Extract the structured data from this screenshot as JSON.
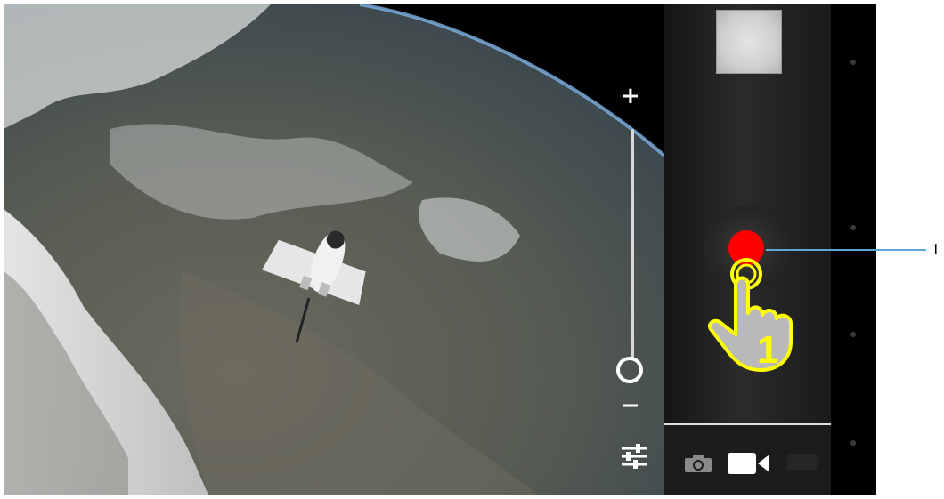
{
  "viewfinder": {
    "scene": "shuttle-over-earth",
    "zoom_in_symbol": "+",
    "zoom_out_symbol": "−",
    "zoom_level": 0.0
  },
  "controls": {
    "thumbnail_icon": "last-photo-thumbnail",
    "shutter_icon": "video-record-button",
    "record_color": "#ff0000",
    "settings_icon": "sliders-icon"
  },
  "modes": {
    "items": [
      {
        "icon": "camera-icon",
        "selected": false
      },
      {
        "icon": "video-camera-icon",
        "selected": true
      },
      {
        "icon": "panorama-icon",
        "selected": false
      }
    ]
  },
  "annotation": {
    "finger_step": "1",
    "callout_label": "1",
    "callout_color": "#5da9d6",
    "hand_color": "#ffff00"
  }
}
